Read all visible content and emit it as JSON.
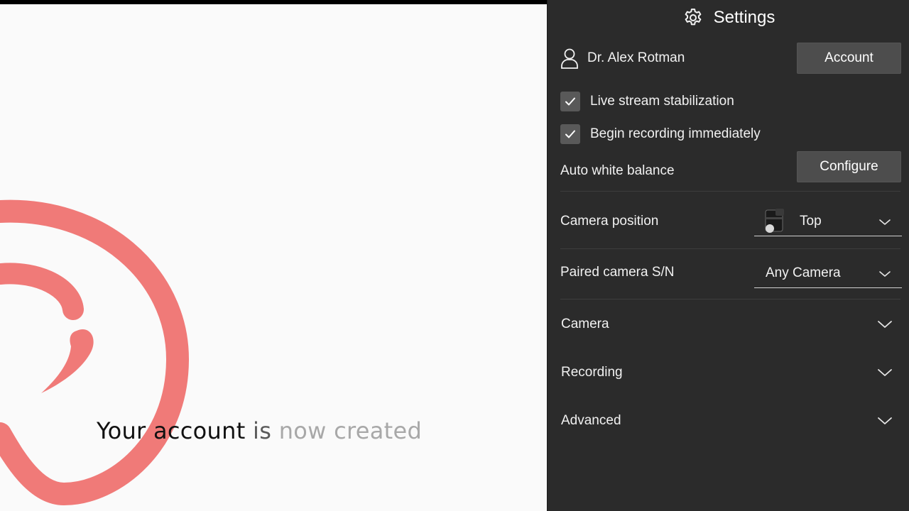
{
  "caption": {
    "part1": "Your account",
    "part2": " is",
    "part3": " now created"
  },
  "settings": {
    "title": "Settings",
    "user": {
      "name": "Dr. Alex Rotman",
      "account_button": "Account"
    },
    "options": [
      {
        "label": "Live stream stabilization",
        "checked": true
      },
      {
        "label": "Begin recording immediately",
        "checked": true
      }
    ],
    "white_balance": {
      "label": "Auto white balance",
      "button": "Configure"
    },
    "camera_position": {
      "label": "Camera position",
      "value": "Top"
    },
    "paired_camera": {
      "label": "Paired camera S/N",
      "value": "Any Camera"
    },
    "sections": [
      {
        "label": "Camera"
      },
      {
        "label": "Recording"
      },
      {
        "label": "Advanced"
      }
    ]
  },
  "colors": {
    "panel_bg": "#2b2b2b",
    "button_bg": "#4d4d4d",
    "logo": "#f07a78",
    "stage_bg": "#fafafa"
  }
}
